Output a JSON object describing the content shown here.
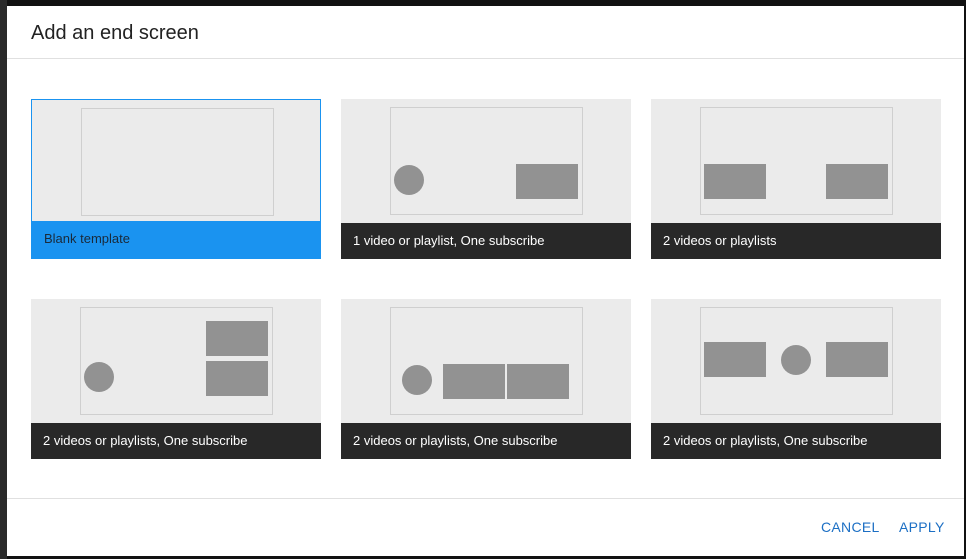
{
  "dialog": {
    "title": "Add an end screen",
    "cancel_label": "CANCEL",
    "apply_label": "APPLY",
    "accent_color": "#1a93f0",
    "button_color": "#1c6fc4"
  },
  "templates": [
    {
      "label": "Blank template",
      "selected": true,
      "elements": []
    },
    {
      "label": "1 video or playlist, One subscribe",
      "selected": false,
      "elements": [
        "subscribe",
        "video"
      ]
    },
    {
      "label": "2 videos or playlists",
      "selected": false,
      "elements": [
        "video",
        "video"
      ]
    },
    {
      "label": "2 videos or playlists, One subscribe",
      "selected": false,
      "elements": [
        "subscribe",
        "video",
        "video"
      ]
    },
    {
      "label": "2 videos or playlists, One subscribe",
      "selected": false,
      "elements": [
        "subscribe",
        "video",
        "video"
      ]
    },
    {
      "label": "2 videos or playlists, One subscribe",
      "selected": false,
      "elements": [
        "video",
        "subscribe",
        "video"
      ]
    }
  ]
}
